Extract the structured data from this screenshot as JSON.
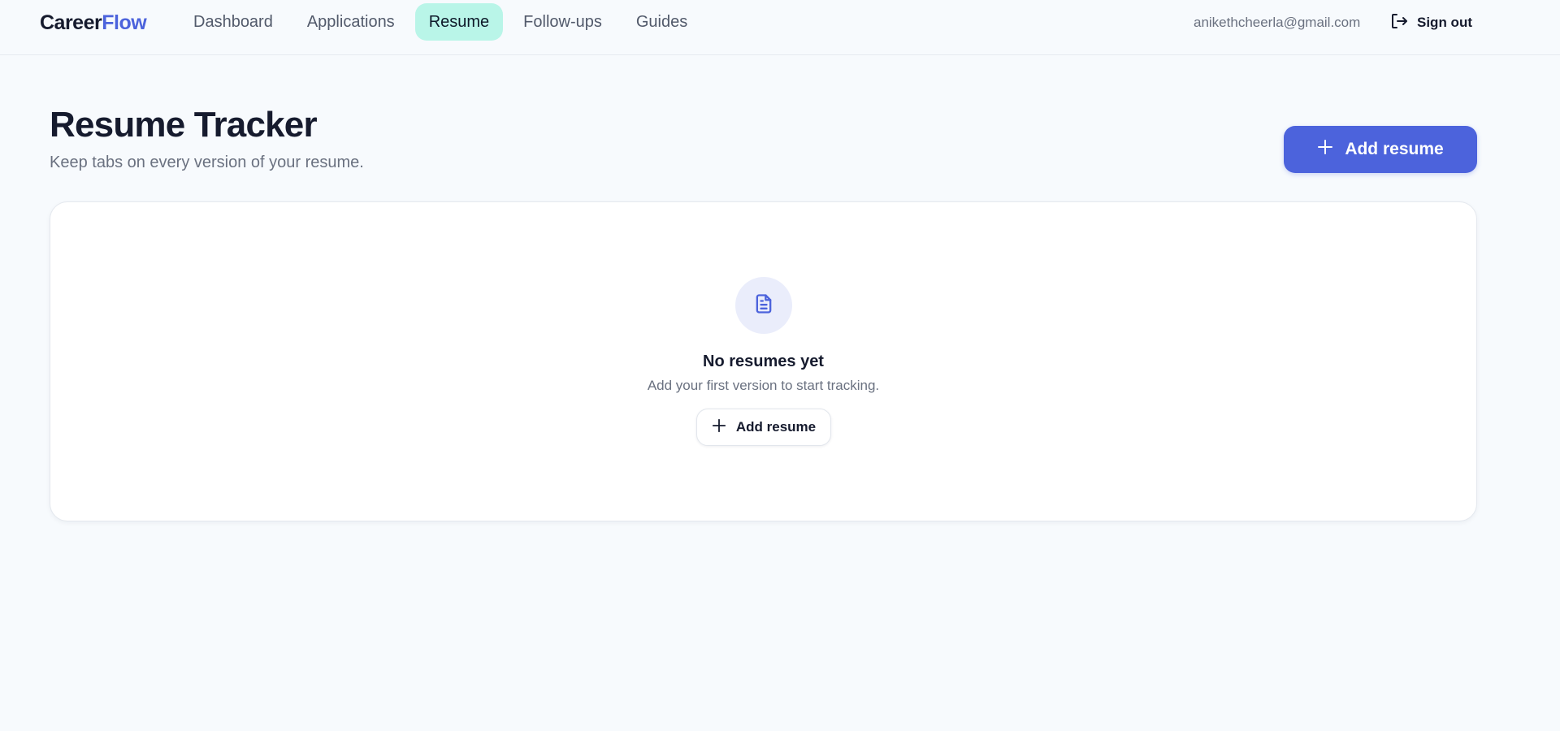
{
  "brand": {
    "part1": "Career",
    "part2": "Flow"
  },
  "nav": {
    "items": [
      {
        "label": "Dashboard"
      },
      {
        "label": "Applications"
      },
      {
        "label": "Resume"
      },
      {
        "label": "Follow-ups"
      },
      {
        "label": "Guides"
      }
    ],
    "active": "Resume"
  },
  "user": {
    "email": "anikethcheerla@gmail.com",
    "sign_out_label": "Sign out",
    "sign_out_icon": "sign-out-icon"
  },
  "header": {
    "title": "Resume Tracker",
    "subtitle": "Keep tabs on every version of your resume.",
    "add_button_label": "Add resume",
    "add_button_icon": "plus-icon"
  },
  "empty_state": {
    "icon": "document-icon",
    "title": "No resumes yet",
    "description": "Add your first version to start tracking.",
    "button_label": "Add resume",
    "button_icon": "plus-icon"
  },
  "colors": {
    "accent": "#4c63dc",
    "active_tab_bg": "#b9f5e8",
    "page_bg": "#f7fafd",
    "icon_circle_bg": "#eaedfb"
  }
}
